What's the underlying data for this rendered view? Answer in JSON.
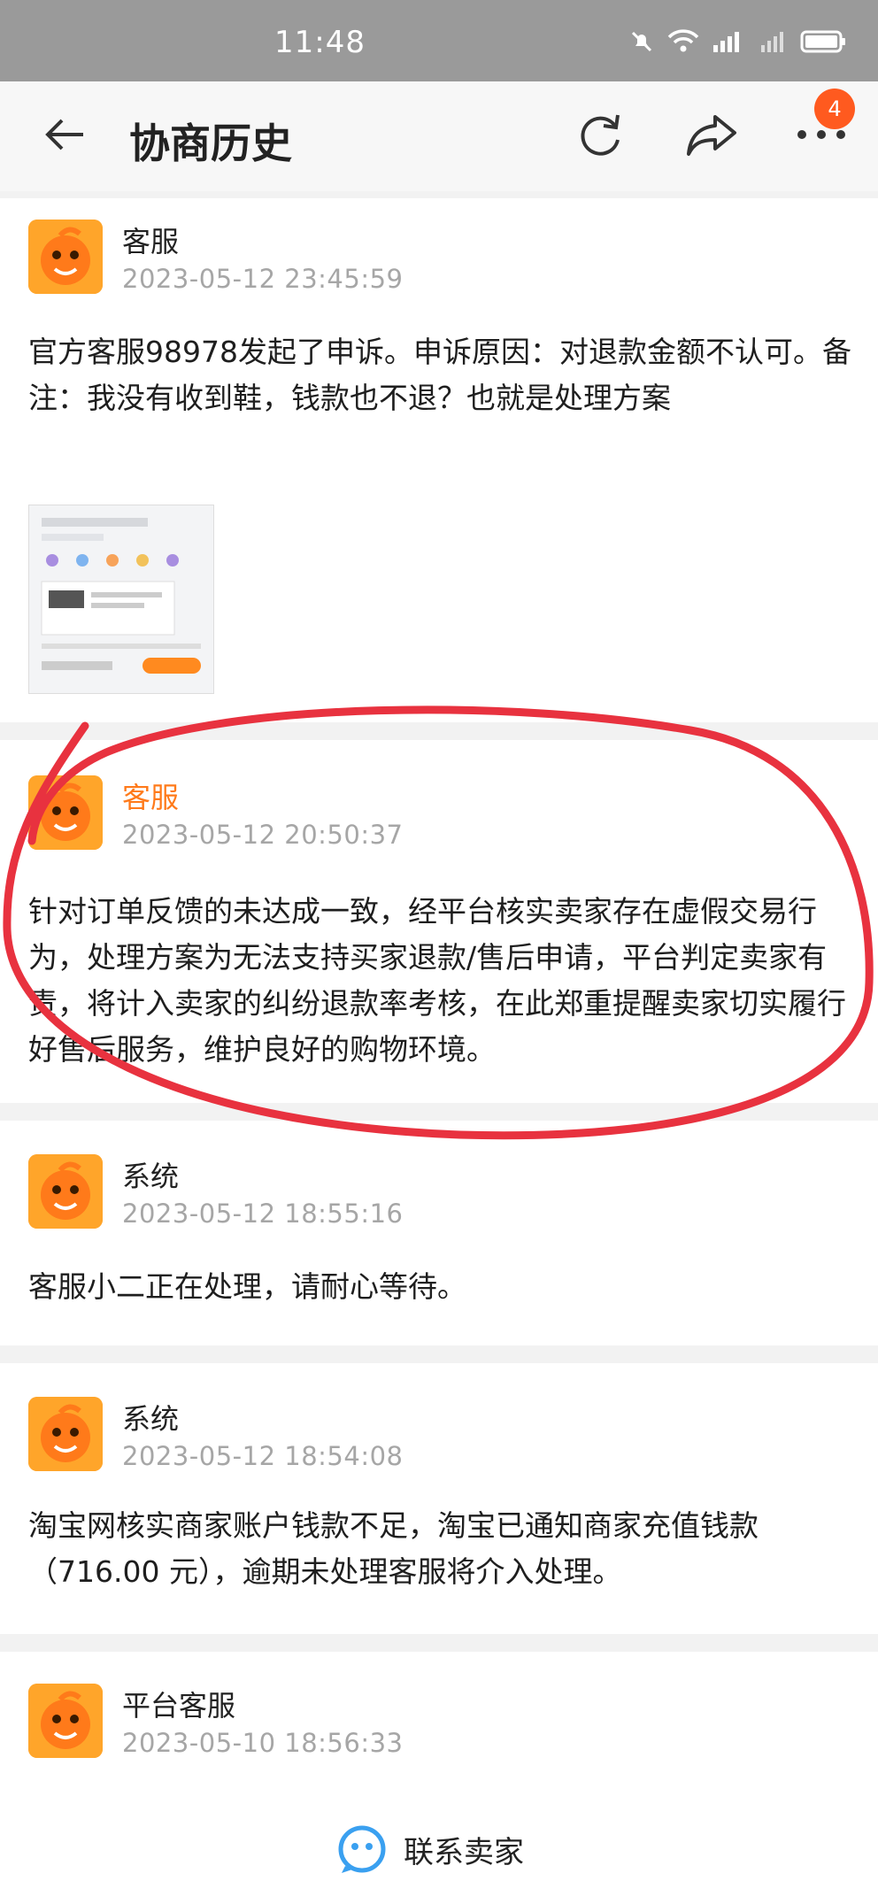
{
  "status_bar": {
    "time": "11:48"
  },
  "header": {
    "title": "协商历史",
    "badge_count": "4"
  },
  "records": [
    {
      "sender": "客服",
      "timestamp": "2023-05-12 23:45:59",
      "message": "官方客服98978发起了申诉。申诉原因：对退款金额不认可。备注：我没有收到鞋，钱款也不退？也就是处理方案"
    },
    {
      "sender": "客服",
      "timestamp": "2023-05-12 20:50:37",
      "message": "针对订单反馈的未达成一致，经平台核实卖家存在虚假交易行为，处理方案为无法支持买家退款/售后申请，平台判定卖家有责，将计入卖家的纠纷退款率考核，在此郑重提醒卖家切实履行好售后服务，维护良好的购物环境。"
    },
    {
      "sender": "系统",
      "timestamp": "2023-05-12 18:55:16",
      "message": "客服小二正在处理，请耐心等待。"
    },
    {
      "sender": "系统",
      "timestamp": "2023-05-12 18:54:08",
      "message": "淘宝网核实商家账户钱款不足，淘宝已通知商家充值钱款（716.00 元），逾期未处理客服将介入处理。"
    },
    {
      "sender": "平台客服",
      "timestamp": "2023-05-10 18:56:33",
      "message": ""
    }
  ],
  "bottom_bar": {
    "contact_label": "联系卖家"
  },
  "colors": {
    "accent": "#ff5a1f",
    "annotation": "#e8323f",
    "avatar": "#ffa52a"
  }
}
